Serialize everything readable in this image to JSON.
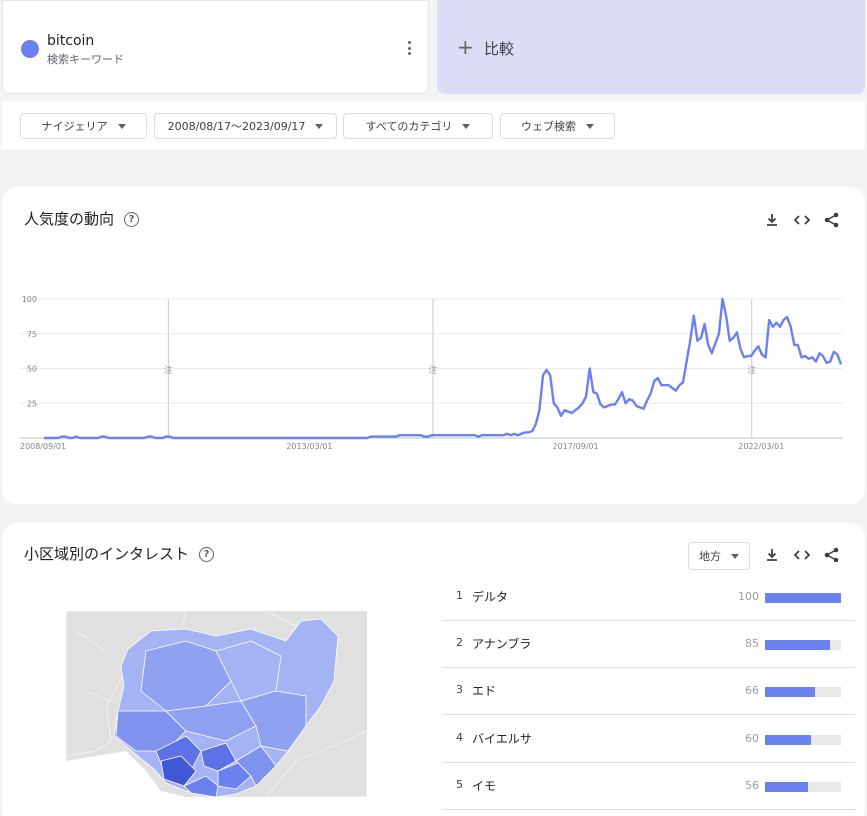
{
  "search_term": {
    "name": "bitcoin",
    "type_label": "検索キーワード",
    "color": "#6b81ef"
  },
  "compare": {
    "label": "比較"
  },
  "filters": [
    {
      "label": "ナイジェリア"
    },
    {
      "label": "2008/08/17～2023/09/17"
    },
    {
      "label": "すべてのカテゴリ"
    },
    {
      "label": "ウェブ検索"
    }
  ],
  "interest_over_time": {
    "title": "人気度の動向",
    "help_glyph": "?",
    "annotation_glyph": "注"
  },
  "chart_data": {
    "type": "line",
    "series": [
      {
        "color": "#6b81ef",
        "values": [
          0,
          0,
          0,
          0,
          0,
          1,
          1,
          0,
          0,
          1,
          0,
          0,
          0,
          0,
          0,
          0,
          1,
          1,
          0,
          0,
          0,
          0,
          0,
          0,
          0,
          0,
          0,
          0,
          0,
          1,
          1,
          0,
          0,
          0,
          1,
          1,
          0,
          0,
          0,
          0,
          0,
          0,
          0,
          0,
          0,
          0,
          0,
          0,
          0,
          0,
          0,
          0,
          0,
          0,
          0,
          0,
          0,
          0,
          0,
          0,
          0,
          0,
          0,
          0,
          0,
          0,
          0,
          0,
          0,
          0,
          0,
          0,
          0,
          0,
          0,
          0,
          0,
          0,
          0,
          0,
          0,
          0,
          0,
          0,
          0,
          0,
          0,
          0,
          0,
          0,
          0,
          1,
          1,
          1,
          1,
          1,
          1,
          1,
          1,
          2,
          2,
          2,
          2,
          2,
          2,
          2,
          1,
          1,
          2,
          2,
          2,
          2,
          2,
          2,
          2,
          2,
          2,
          2,
          2,
          2,
          2,
          1,
          2,
          2,
          2,
          2,
          2,
          2,
          2,
          3,
          2,
          3,
          2,
          3,
          4,
          4,
          5,
          10,
          20,
          45,
          49,
          45,
          25,
          22,
          16,
          20,
          19,
          18,
          20,
          22,
          25,
          30,
          50,
          33,
          32,
          24,
          22,
          23,
          24,
          24,
          28,
          33,
          25,
          28,
          27,
          23,
          22,
          21,
          27,
          32,
          41,
          43,
          38,
          38,
          38,
          36,
          34,
          38,
          40,
          55,
          70,
          88,
          70,
          72,
          82,
          67,
          61,
          68,
          75,
          100,
          88,
          70,
          72,
          76,
          64,
          58,
          59,
          59,
          63,
          66,
          60,
          58,
          85,
          80,
          83,
          80,
          85,
          87,
          80,
          67,
          67,
          58,
          59,
          57,
          58,
          55,
          61,
          59,
          54,
          55,
          62,
          60,
          53
        ]
      }
    ],
    "x_tick_labels": [
      "2008/09/01",
      "2013/03/01",
      "2017/09/01",
      "2022/03/01"
    ],
    "y_tick_labels": [
      "100",
      "75",
      "50",
      "25"
    ],
    "ylim": [
      0,
      100
    ],
    "grid": true,
    "annotation_markers": 3
  },
  "subregion": {
    "title": "小区域別のインタレスト",
    "help_glyph": "?",
    "resolution_label": "地方",
    "map_colors": {
      "background": "#e0e0e0",
      "light": "#a4b3f3",
      "mid": "#8fa1f0",
      "strong": "#6b81ef",
      "darkest": "#3f58d6"
    },
    "rows": [
      {
        "rank": "1",
        "name": "デルタ",
        "value": "100",
        "fraction": 1.0
      },
      {
        "rank": "2",
        "name": "アナンブラ",
        "value": "85",
        "fraction": 0.85
      },
      {
        "rank": "3",
        "name": "エド",
        "value": "66",
        "fraction": 0.66
      },
      {
        "rank": "4",
        "name": "バイエルサ",
        "value": "60",
        "fraction": 0.6
      },
      {
        "rank": "5",
        "name": "イモ",
        "value": "56",
        "fraction": 0.56
      }
    ]
  }
}
